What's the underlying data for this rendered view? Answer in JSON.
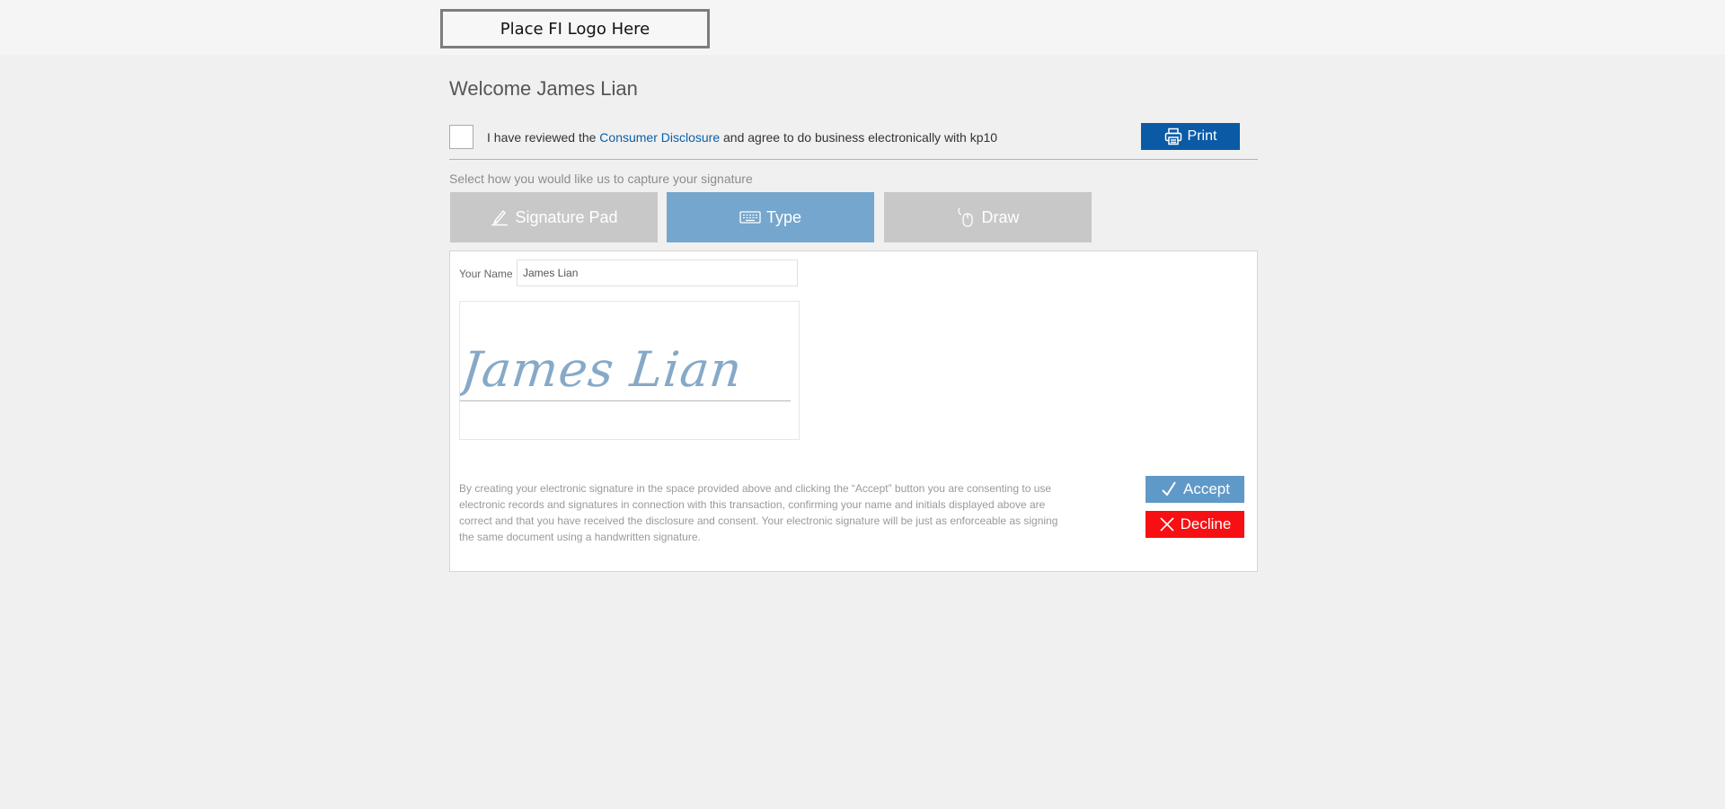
{
  "header": {
    "logo_text": "Place FI Logo Here"
  },
  "welcome": "Welcome James Lian",
  "consent": {
    "prefix": "I have reviewed the ",
    "link_text": "Consumer Disclosure",
    "suffix": " and agree to do business electronically with kp10",
    "checked": false
  },
  "print_button": {
    "label": "Print",
    "icon": "printer-icon"
  },
  "capture": {
    "prompt": "Select how you would like us to capture your signature",
    "tabs": [
      {
        "label": "Signature Pad",
        "icon": "pen-icon",
        "active": false
      },
      {
        "label": "Type",
        "icon": "keyboard-icon",
        "active": true
      },
      {
        "label": "Draw",
        "icon": "mouse-icon",
        "active": false
      }
    ]
  },
  "form": {
    "name_label": "Your Name",
    "name_value": "James Lian",
    "signature_preview": "James Lian"
  },
  "legal": "By creating your electronic signature in the space provided above and clicking the “Accept” button you are consenting to use electronic records and signatures in connection with this transaction, confirming your name and initials displayed above are correct and that you have received the disclosure and consent. Your electronic signature will be just as enforceable as signing the same document using a handwritten signature.",
  "actions": {
    "accept_label": "Accept",
    "decline_label": "Decline"
  },
  "colors": {
    "primary": "#0b5aa6",
    "active_tab": "#75a6cd",
    "inactive_tab": "#c8c8c8",
    "accept": "#5f99c8",
    "decline": "#f70f13",
    "link": "#0a60a8",
    "signature_ink": "#86a9c8"
  }
}
